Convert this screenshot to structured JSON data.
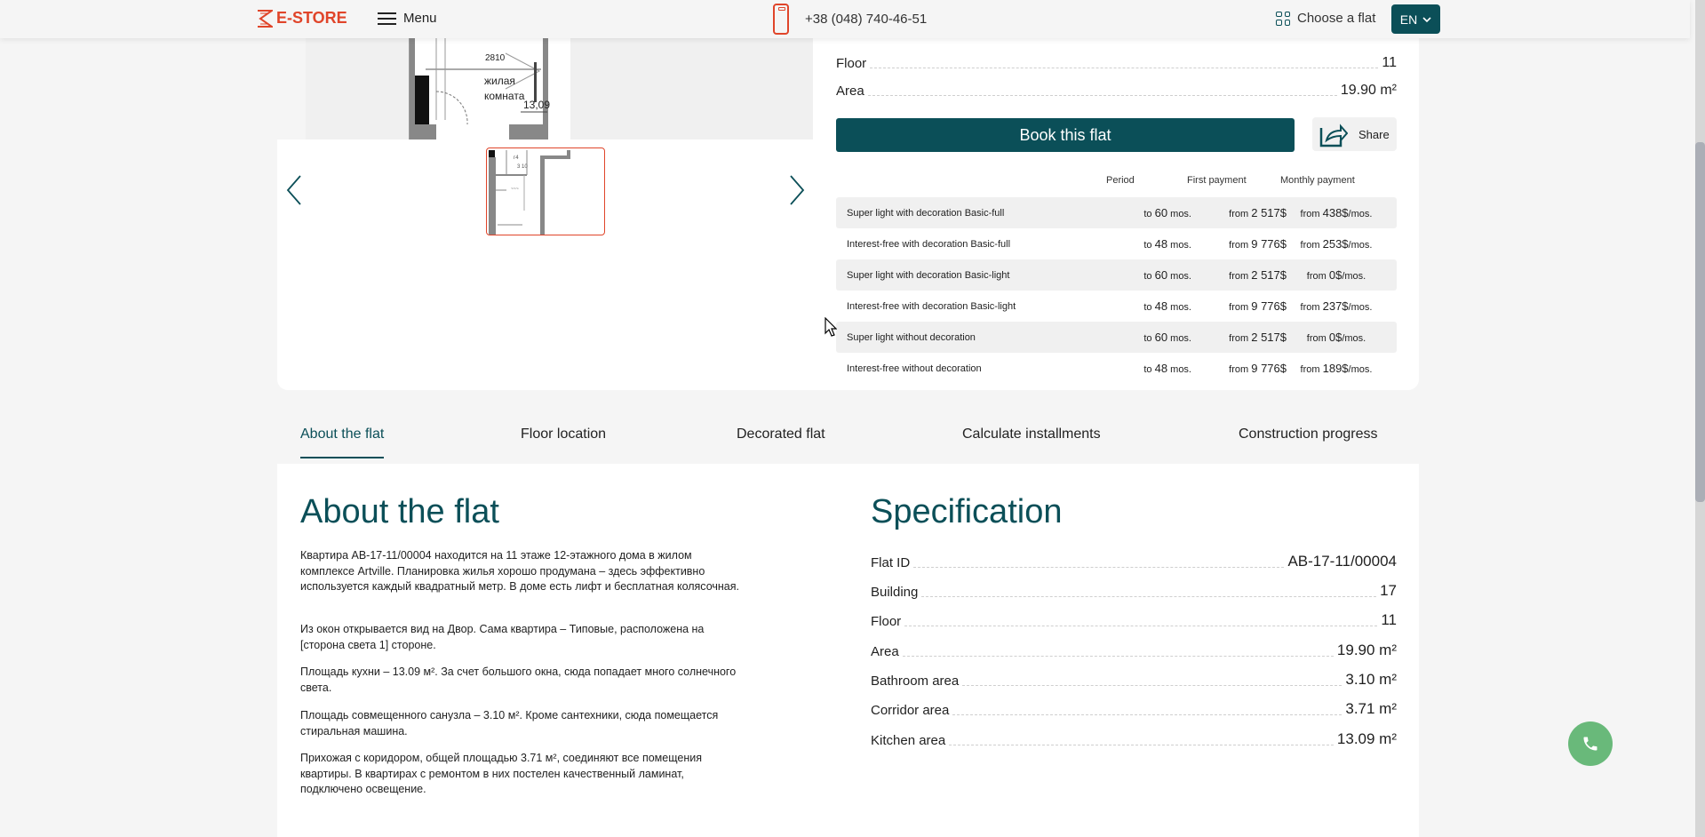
{
  "header": {
    "logo_text": "E-STORE",
    "menu_label": "Menu",
    "phone": "+38 (048) 740-46-51",
    "choose_flat_label": "Choose a flat",
    "language": "EN"
  },
  "colors": {
    "brand_red": "#e0452a",
    "brand_teal": "#0b4f58",
    "call_green": "#69b97a"
  },
  "flat_summary": {
    "rows": [
      {
        "label": "Floor",
        "value": "11"
      },
      {
        "label": "Area",
        "value": "19.90 m²"
      }
    ],
    "book_button": "Book this flat",
    "share_button": "Share"
  },
  "payments": {
    "headers": {
      "period": "Period",
      "first": "First payment",
      "monthly": "Monthly payment"
    },
    "rows": [
      {
        "name": "Super light with decoration Basic-full",
        "period_prefix": "to",
        "period_value": "60",
        "period_unit": "mos.",
        "first_prefix": "from",
        "first_value": "2 517$",
        "monthly_prefix": "from",
        "monthly_value": "438$",
        "monthly_unit": "/mos."
      },
      {
        "name": "Interest-free with decoration Basic-full",
        "period_prefix": "to",
        "period_value": "48",
        "period_unit": "mos.",
        "first_prefix": "from",
        "first_value": "9 776$",
        "monthly_prefix": "from",
        "monthly_value": "253$",
        "monthly_unit": "/mos."
      },
      {
        "name": "Super light with decoration Basic-light",
        "period_prefix": "to",
        "period_value": "60",
        "period_unit": "mos.",
        "first_prefix": "from",
        "first_value": "2 517$",
        "monthly_prefix": "from",
        "monthly_value": "0$",
        "monthly_unit": "/mos."
      },
      {
        "name": "Interest-free with decoration Basic-light",
        "period_prefix": "to",
        "period_value": "48",
        "period_unit": "mos.",
        "first_prefix": "from",
        "first_value": "9 776$",
        "monthly_prefix": "from",
        "monthly_value": "237$",
        "monthly_unit": "/mos."
      },
      {
        "name": "Super light without decoration",
        "period_prefix": "to",
        "period_value": "60",
        "period_unit": "mos.",
        "first_prefix": "from",
        "first_value": "2 517$",
        "monthly_prefix": "from",
        "monthly_value": "0$",
        "monthly_unit": "/mos."
      },
      {
        "name": "Interest-free without decoration",
        "period_prefix": "to",
        "period_value": "48",
        "period_unit": "mos.",
        "first_prefix": "from",
        "first_value": "9 776$",
        "monthly_prefix": "from",
        "monthly_value": "189$",
        "monthly_unit": "/mos."
      }
    ]
  },
  "plan": {
    "room_label_1": "жилая",
    "room_label_2": "комната",
    "room_area": "13,09",
    "dimension": "2810"
  },
  "tabs": [
    {
      "label": "About the flat",
      "active": true
    },
    {
      "label": "Floor location",
      "active": false
    },
    {
      "label": "Decorated flat",
      "active": false
    },
    {
      "label": "Calculate installments",
      "active": false
    },
    {
      "label": "Construction progress",
      "active": false
    }
  ],
  "about": {
    "title": "About the flat",
    "paragraphs": [
      "Квартира AB-17-11/00004 находится на 11 этаже 12-этажного дома в жилом комплексе Artville. Планировка жилья хорошо продумана – здесь эффективно используется каждый квадратный метр. В доме есть лифт и бесплатная колясочная.",
      "Из окон открывается вид на Двор. Сама квартира – Типовые, расположена на [сторона света 1] стороне.",
      "Площадь кухни – 13.09 м². За счет большого окна, сюда попадает много солнечного света.",
      "Площадь совмещенного санузла – 3.10 м². Кроме сантехники, сюда помещается стиральная машина.",
      "Прихожая с коридором, общей площадью 3.71 м², соединяют все помещения квартиры. В квартирах с ремонтом в них постелен качественный ламинат, подключено освещение."
    ]
  },
  "specification": {
    "title": "Specification",
    "rows": [
      {
        "label": "Flat ID",
        "value": "AB-17-11/00004"
      },
      {
        "label": "Building",
        "value": "17"
      },
      {
        "label": "Floor",
        "value": "11"
      },
      {
        "label": "Area",
        "value": "19.90 m²"
      },
      {
        "label": "Bathroom area",
        "value": "3.10 m²"
      },
      {
        "label": "Corridor area",
        "value": "3.71 m²"
      },
      {
        "label": "Kitchen area",
        "value": "13.09 m²"
      }
    ]
  }
}
